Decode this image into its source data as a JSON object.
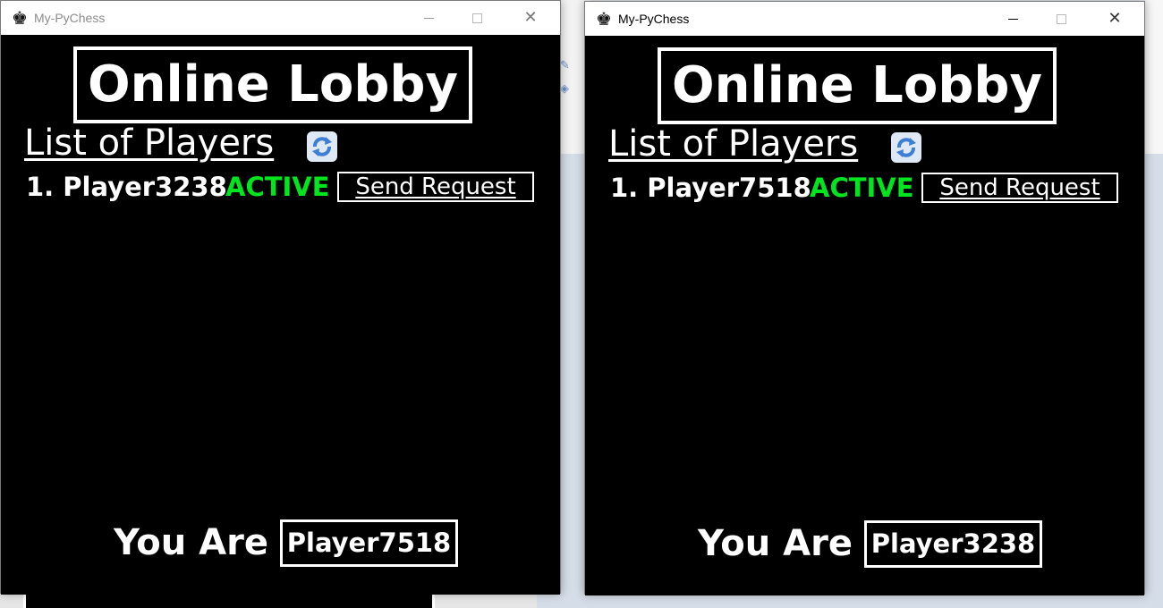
{
  "colors": {
    "window_bg": "#000000",
    "text": "#ffffff",
    "active_status": "#00e61e",
    "titlebar_bg": "#ffffff"
  },
  "windows": [
    {
      "title": "My-PyChess",
      "app_icon": "chess-king-icon",
      "lobby_title": "Online Lobby",
      "players_heading": "List of Players",
      "refresh_icon": "refresh-icon",
      "players": [
        {
          "name": "1. Player3238",
          "status": "ACTIVE",
          "action_label": "Send Request"
        }
      ],
      "you_are_label": "You Are",
      "you_name": "Player7518"
    },
    {
      "title": "My-PyChess",
      "app_icon": "chess-king-icon",
      "lobby_title": "Online Lobby",
      "players_heading": "List of Players",
      "refresh_icon": "refresh-icon",
      "players": [
        {
          "name": "1. Player7518",
          "status": "ACTIVE",
          "action_label": "Send Request"
        }
      ],
      "you_are_label": "You Are",
      "you_name": "Player3238"
    }
  ]
}
